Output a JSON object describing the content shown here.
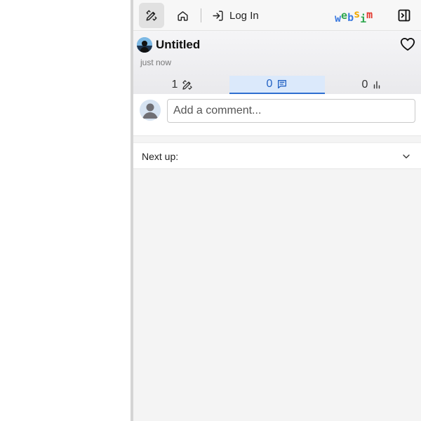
{
  "toolbar": {
    "tools_icon": "wrench-pencil-icon",
    "home_icon": "home-icon",
    "login_icon": "login-arrow-icon",
    "login_label": "Log In",
    "logo_letters": [
      {
        "ch": "w",
        "color": "#3d7be0"
      },
      {
        "ch": "e",
        "color": "#2fa84f"
      },
      {
        "ch": "b",
        "color": "#3d7be0"
      },
      {
        "ch": "s",
        "color": "#f2a900"
      },
      {
        "ch": "i",
        "color": "#2fa84f"
      },
      {
        "ch": "m",
        "color": "#e2362b"
      }
    ],
    "collapse_icon": "panel-collapse-icon"
  },
  "project": {
    "title": "Untitled",
    "time": "just now"
  },
  "stats": {
    "remixes": "1",
    "comments": "0",
    "views": "0"
  },
  "comment": {
    "placeholder": "Add a comment..."
  },
  "nextup": {
    "label": "Next up:"
  },
  "colors": {
    "accent": "#2f6fd0",
    "active_tab_bg": "#dbe9fb"
  }
}
